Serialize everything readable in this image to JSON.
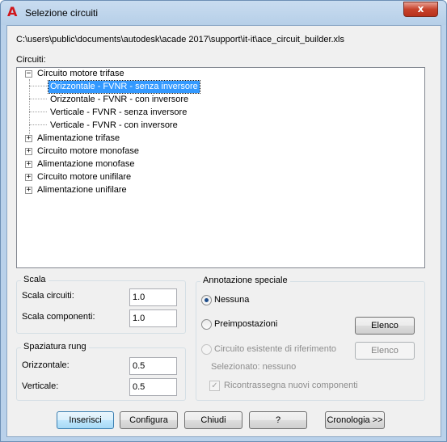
{
  "window": {
    "title": "Selezione circuiti",
    "close_glyph": "x",
    "app_icon": "autocad-a-icon",
    "app_icon_glyph": "A"
  },
  "file_path": "C:\\users\\public\\documents\\autodesk\\acade 2017\\support\\it-it\\ace_circuit_builder.xls",
  "circuiti_label": "Circuiti:",
  "tree": {
    "root_expanded": {
      "label": "Circuito motore trifase",
      "expander": "−",
      "children": [
        "Orizzontale - FVNR - senza inversore",
        "Orizzontale - FVNR - con inversore",
        "Verticale - FVNR - senza inversore",
        "Verticale - FVNR - con inversore"
      ],
      "selected_child": "Orizzontale - FVNR - senza inversore"
    },
    "collapsed": [
      "Alimentazione trifase",
      "Circuito motore monofase",
      "Alimentazione monofase",
      "Circuito motore unifilare",
      "Alimentazione unifilare"
    ],
    "collapsed_expander": "+"
  },
  "scala": {
    "title": "Scala",
    "circuiti_label": "Scala circuiti:",
    "circuiti_value": "1.0",
    "componenti_label": "Scala componenti:",
    "componenti_value": "1.0"
  },
  "spaziatura": {
    "title": "Spaziatura rung",
    "orizzontale_label": "Orizzontale:",
    "orizzontale_value": "0.5",
    "verticale_label": "Verticale:",
    "verticale_value": "0.5"
  },
  "annotazione": {
    "title": "Annotazione speciale",
    "nessuna_label": "Nessuna",
    "preimpostazioni_label": "Preimpostazioni",
    "elenco_label": "Elenco",
    "circuito_esistente_label": "Circuito esistente di riferimento",
    "elenco2_label": "Elenco",
    "selezionato_label": "Selezionato: nessuno",
    "ricontrassegna_label": "Ricontrassegna nuovi componenti",
    "check_glyph": "✓"
  },
  "buttons": {
    "inserisci": "Inserisci",
    "configura": "Configura",
    "chiudi": "Chiudi",
    "help": "?",
    "cronologia": "Cronologia >>"
  },
  "colors": {
    "selection": "#3399ff",
    "title_bar": "#b9d1ea",
    "close_button": "#c7422b"
  }
}
